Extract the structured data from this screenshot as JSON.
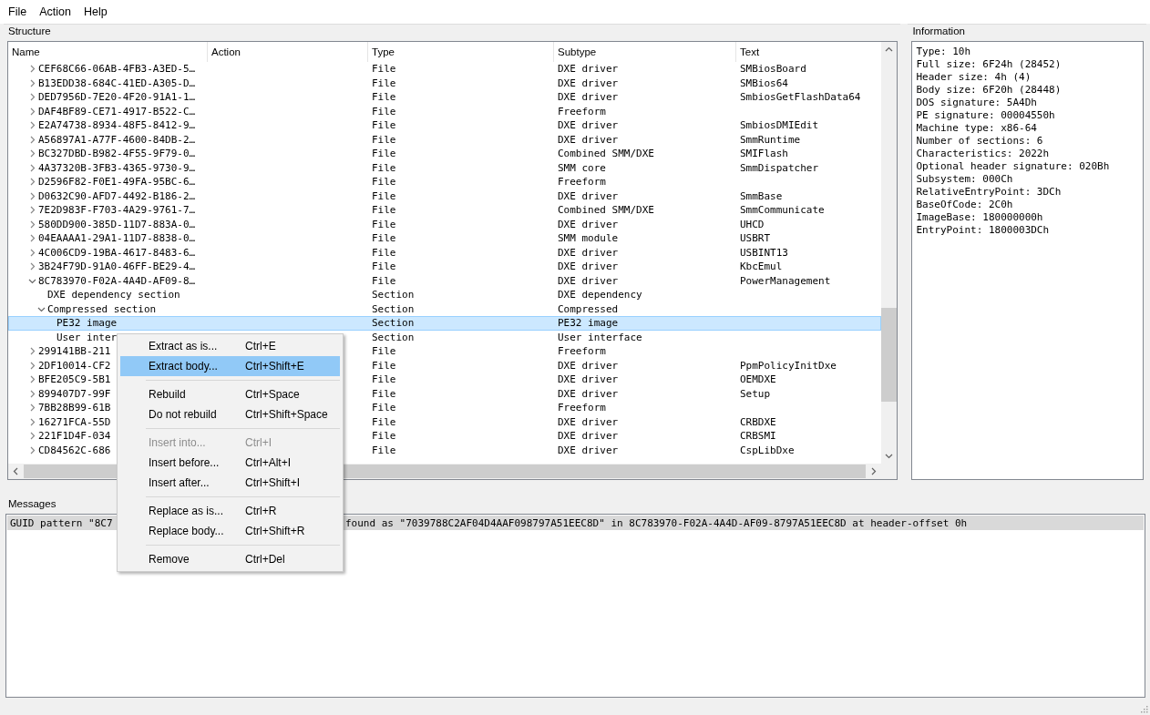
{
  "menu_bar": [
    "File",
    "Action",
    "Help"
  ],
  "structure": {
    "title": "Structure",
    "columns": [
      "Name",
      "Action",
      "Type",
      "Subtype",
      "Text"
    ],
    "rows": [
      {
        "name": "CEF68C66-06AB-4FB3-A3ED-5…",
        "type": "File",
        "subtype": "DXE driver",
        "text": "SMBiosBoard",
        "expanded": false,
        "selected": false
      },
      {
        "name": "B13EDD38-684C-41ED-A305-D…",
        "type": "File",
        "subtype": "DXE driver",
        "text": "SMBios64",
        "expanded": false,
        "selected": false
      },
      {
        "name": "DED7956D-7E20-4F20-91A1-1…",
        "type": "File",
        "subtype": "DXE driver",
        "text": "SmbiosGetFlashData64",
        "expanded": false,
        "selected": false
      },
      {
        "name": "DAF4BF89-CE71-4917-B522-C…",
        "type": "File",
        "subtype": "Freeform",
        "expanded": false,
        "selected": false
      },
      {
        "name": "E2A74738-8934-48F5-8412-9…",
        "type": "File",
        "subtype": "DXE driver",
        "text": "SmbiosDMIEdit",
        "expanded": false,
        "selected": false
      },
      {
        "name": "A56897A1-A77F-4600-84DB-2…",
        "type": "File",
        "subtype": "DXE driver",
        "text": "SmmRuntime",
        "expanded": false,
        "selected": false
      },
      {
        "name": "BC327DBD-B982-4F55-9F79-0…",
        "type": "File",
        "subtype": "Combined SMM/DXE",
        "text": "SMIFlash",
        "expanded": false,
        "selected": false
      },
      {
        "name": "4A37320B-3FB3-4365-9730-9…",
        "type": "File",
        "subtype": "SMM core",
        "text": "SmmDispatcher",
        "expanded": false,
        "selected": false
      },
      {
        "name": "D2596F82-F0E1-49FA-95BC-6…",
        "type": "File",
        "subtype": "Freeform",
        "expanded": false,
        "selected": false
      },
      {
        "name": "D0632C90-AFD7-4492-B186-2…",
        "type": "File",
        "subtype": "DXE driver",
        "text": "SmmBase",
        "expanded": false,
        "selected": false
      },
      {
        "name": "7E2D983F-F703-4A29-9761-7…",
        "type": "File",
        "subtype": "Combined SMM/DXE",
        "text": "SmmCommunicate",
        "expanded": false,
        "selected": false
      },
      {
        "name": "580DD900-385D-11D7-883A-0…",
        "type": "File",
        "subtype": "DXE driver",
        "text": "UHCD",
        "expanded": false,
        "selected": false
      },
      {
        "name": "04EAAAA1-29A1-11D7-8838-0…",
        "type": "File",
        "subtype": "SMM module",
        "text": "USBRT",
        "expanded": false,
        "selected": false
      },
      {
        "name": "4C006CD9-19BA-4617-8483-6…",
        "type": "File",
        "subtype": "DXE driver",
        "text": "USBINT13",
        "expanded": false,
        "selected": false
      },
      {
        "name": "3B24F79D-91A0-46FF-BE29-4…",
        "type": "File",
        "subtype": "DXE driver",
        "text": "KbcEmul",
        "expanded": false,
        "selected": false
      },
      {
        "name": "8C783970-F02A-4A4D-AF09-8…",
        "type": "File",
        "subtype": "DXE driver",
        "text": "PowerManagement",
        "expanded": true,
        "selected": false,
        "children": [
          {
            "name": "DXE dependency section",
            "type": "Section",
            "subtype": "DXE dependency",
            "selected": false
          },
          {
            "name": "Compressed section",
            "type": "Section",
            "subtype": "Compressed",
            "expanded": true,
            "selected": false,
            "children": [
              {
                "name": "PE32 image",
                "type": "Section",
                "subtype": "PE32 image",
                "selected": true
              },
              {
                "name": "User inter",
                "type": "Section",
                "subtype": "User interface",
                "selected": false
              }
            ]
          }
        ]
      },
      {
        "name": "299141BB-211",
        "type": "File",
        "subtype": "Freeform",
        "expanded": false,
        "selected": false
      },
      {
        "name": "2DF10014-CF2",
        "type": "File",
        "subtype": "DXE driver",
        "text": "PpmPolicyInitDxe",
        "expanded": false,
        "selected": false
      },
      {
        "name": "BFE205C9-5B1",
        "type": "File",
        "subtype": "DXE driver",
        "text": "OEMDXE",
        "expanded": false,
        "selected": false
      },
      {
        "name": "899407D7-99F",
        "type": "File",
        "subtype": "DXE driver",
        "text": "Setup",
        "expanded": false,
        "selected": false
      },
      {
        "name": "7BB28B99-61B",
        "type": "File",
        "subtype": "Freeform",
        "expanded": false,
        "selected": false
      },
      {
        "name": "16271FCA-55D",
        "type": "File",
        "subtype": "DXE driver",
        "text": "CRBDXE",
        "expanded": false,
        "selected": false
      },
      {
        "name": "221F1D4F-034",
        "type": "File",
        "subtype": "DXE driver",
        "text": "CRBSMI",
        "expanded": false,
        "selected": false
      },
      {
        "name": "CD84562C-686",
        "type": "File",
        "subtype": "DXE driver",
        "text": "CspLibDxe",
        "expanded": false,
        "selected": false
      }
    ]
  },
  "information": {
    "title": "Information",
    "lines": [
      "Type: 10h",
      "Full size: 6F24h (28452)",
      "Header size: 4h (4)",
      "Body size: 6F20h (28448)",
      "DOS signature: 5A4Dh",
      "PE signature: 00004550h",
      "Machine type: x86-64",
      "Number of sections: 6",
      "Characteristics: 2022h",
      "Optional header signature: 020Bh",
      "Subsystem: 000Ch",
      "RelativeEntryPoint: 3DCh",
      "BaseOfCode: 2C0h",
      "ImageBase: 180000000h",
      "EntryPoint: 1800003DCh"
    ]
  },
  "messages": {
    "title": "Messages",
    "items": [
      {
        "parts": [
          "GUID pattern \"8C7",
          "found as \"7039788C2AF04D4AAF098797A51EEC8D\" in 8C783970-F02A-4A4D-AF09-8797A51EEC8D at header-offset 0h"
        ],
        "selected": true
      }
    ]
  },
  "context_menu": [
    {
      "kind": "item",
      "label": "Extract as is...",
      "shortcut": "Ctrl+E",
      "disabled": false,
      "selected": false
    },
    {
      "kind": "item",
      "label": "Extract body...",
      "shortcut": "Ctrl+Shift+E",
      "disabled": false,
      "selected": true
    },
    {
      "kind": "separator"
    },
    {
      "kind": "item",
      "label": "Rebuild",
      "shortcut": "Ctrl+Space",
      "disabled": false,
      "selected": false
    },
    {
      "kind": "item",
      "label": "Do not rebuild",
      "shortcut": "Ctrl+Shift+Space",
      "disabled": false,
      "selected": false
    },
    {
      "kind": "separator"
    },
    {
      "kind": "item",
      "label": "Insert into...",
      "shortcut": "Ctrl+I",
      "disabled": true,
      "selected": false
    },
    {
      "kind": "item",
      "label": "Insert before...",
      "shortcut": "Ctrl+Alt+I",
      "disabled": false,
      "selected": false
    },
    {
      "kind": "item",
      "label": "Insert after...",
      "shortcut": "Ctrl+Shift+I",
      "disabled": false,
      "selected": false
    },
    {
      "kind": "separator"
    },
    {
      "kind": "item",
      "label": "Replace as is...",
      "shortcut": "Ctrl+R",
      "disabled": false,
      "selected": false
    },
    {
      "kind": "item",
      "label": "Replace body...",
      "shortcut": "Ctrl+Shift+R",
      "disabled": false,
      "selected": false
    },
    {
      "kind": "separator"
    },
    {
      "kind": "item",
      "label": "Remove",
      "shortcut": "Ctrl+Del",
      "disabled": false,
      "selected": false
    }
  ]
}
